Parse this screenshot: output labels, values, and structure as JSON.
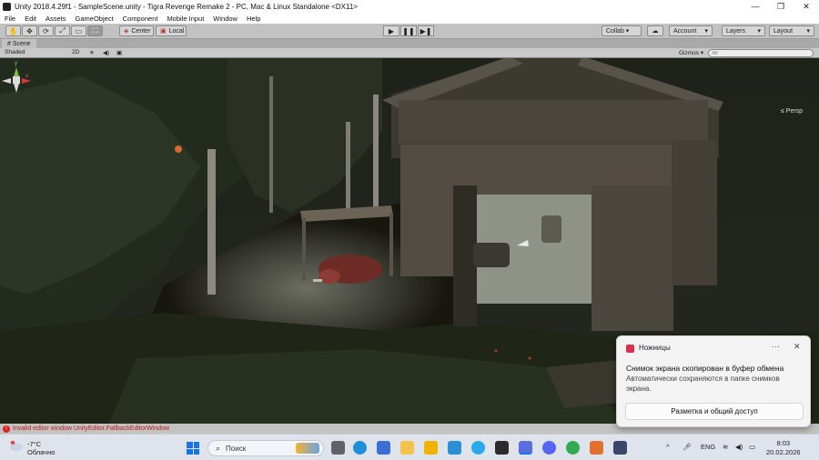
{
  "window": {
    "title": "Unity 2018.4.29f1 - SampleScene.unity - Tigra Revenge Remake 2 - PC, Mac & Linux Standalone <DX11>",
    "controls": [
      "—",
      "❐",
      "✕"
    ]
  },
  "menu": [
    "File",
    "Edit",
    "Assets",
    "GameObject",
    "Component",
    "Mobile Input",
    "Window",
    "Help"
  ],
  "toolbar": {
    "tools": [
      "✋",
      "✥",
      "⟳",
      "⤢",
      "▭",
      "⛶"
    ],
    "pivot_label": "Center",
    "space_label": "Local",
    "playback": [
      "▶",
      "❚❚",
      "▶❚"
    ],
    "collab_label": "Collab ▾",
    "cloud_icon": "cloud-icon",
    "account_label": "Account",
    "layers_label": "Layers",
    "layout_label": "Layout"
  },
  "scene": {
    "tab_label": "Scene",
    "shading_label": "Shaded",
    "mode_2d": "2D",
    "gizmos_label": "Gizmos ▾",
    "search_placeholder": "All",
    "gizmo_axes": {
      "x": "x",
      "y": "y"
    },
    "projection_label": "≤ Persp"
  },
  "console": {
    "error_text": "Invalid editor window UnityEditor.FallbackEditorWindow"
  },
  "toast": {
    "app_name": "Ножницы",
    "more": "···",
    "close": "✕",
    "headline": "Снимок экрана скопирован в буфер обмена",
    "body": "Автоматически сохраняются в папке снимков экрана.",
    "action": "Разметка и общий доступ"
  },
  "taskbar": {
    "weather": {
      "temp": "-7°C",
      "condition": "Облачно",
      "badge": "1"
    },
    "search_label": "Поиск",
    "language": "ENG",
    "time": "8:03",
    "date": "20.02.2026",
    "tray_up": "^"
  },
  "colors": {
    "accent": "#1a73e8",
    "error": "#c01a1a",
    "toast_app": "#d8324a"
  }
}
